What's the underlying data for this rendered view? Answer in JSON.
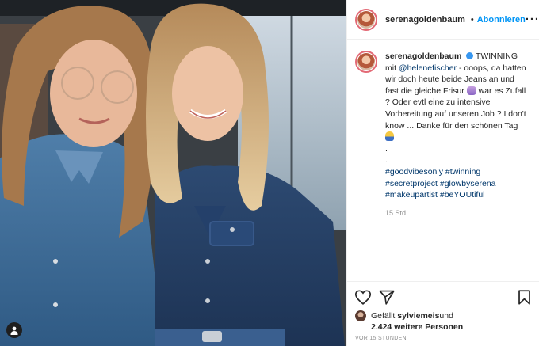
{
  "header": {
    "username": "serenagoldenbaum",
    "follow_label": "Abonnieren",
    "more_glyph": "···"
  },
  "caption": {
    "username": "serenagoldenbaum",
    "part1": " TWINNING mit ",
    "mention": "@helenefischer",
    "part2": " - ooops, da hatten wir doch heute beide Jeans an und fast die gleiche Frisur ",
    "part3": " war es Zufall ? Oder evtl eine zu intensive Vorbereitung auf unseren Job ? I don't know ... Danke für den schönen Tag ",
    "dot1": ".",
    "dot2": ".",
    "hashtags": [
      "#goodvibesonly",
      "#twinning",
      "#secretproject",
      "#glowbyserena",
      "#makeupartist",
      "#beYOUtiful"
    ],
    "time_ago": "15 Std."
  },
  "likes": {
    "prefix": "Gefällt ",
    "user": "sylviemeis",
    "conj": " und",
    "others": "2.424 weitere Personen"
  },
  "timestamp": "VOR 15 STUNDEN",
  "icons": [
    "heart-icon",
    "share-icon",
    "bookmark-icon",
    "user-tag-icon",
    "verified-badge-icon"
  ],
  "colors": {
    "accent": "#0095f6",
    "verified": "#3897f0",
    "link": "#00376b"
  }
}
